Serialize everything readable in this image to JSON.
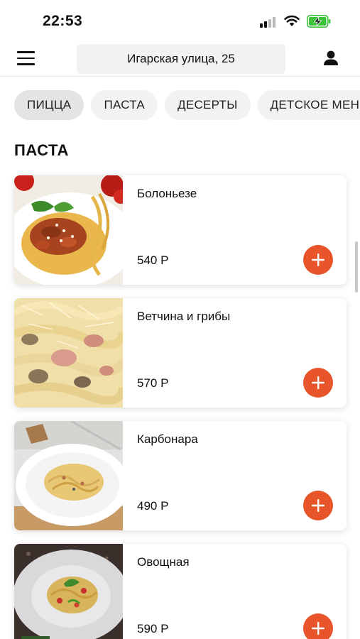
{
  "status_bar": {
    "time": "22:53",
    "icons": [
      "signal-icon",
      "wifi-icon",
      "battery-charging-icon"
    ],
    "battery_color": "#3cc13b"
  },
  "header": {
    "menu_icon": "hamburger-menu-icon",
    "address": "Игарская улица, 25",
    "profile_icon": "user-icon"
  },
  "categories": [
    {
      "label": "ПИЦЦА",
      "active": true
    },
    {
      "label": "ПАСТА",
      "active": false
    },
    {
      "label": "ДЕСЕРТЫ",
      "active": false
    },
    {
      "label": "ДЕТСКОЕ МЕНЮ",
      "active": false
    }
  ],
  "section": {
    "title": "ПАСТА"
  },
  "products": [
    {
      "name": "Болоньезе",
      "price": "540 Р",
      "add_icon": "plus-icon"
    },
    {
      "name": "Ветчина и грибы",
      "price": "570 Р",
      "add_icon": "plus-icon"
    },
    {
      "name": "Карбонара",
      "price": "490 Р",
      "add_icon": "plus-icon"
    },
    {
      "name": "Овощная",
      "price": "590 Р",
      "add_icon": "plus-icon"
    }
  ],
  "colors": {
    "accent": "#e8552a",
    "chip_bg": "#f2f2f2",
    "chip_active_bg": "#e4e4e4"
  }
}
